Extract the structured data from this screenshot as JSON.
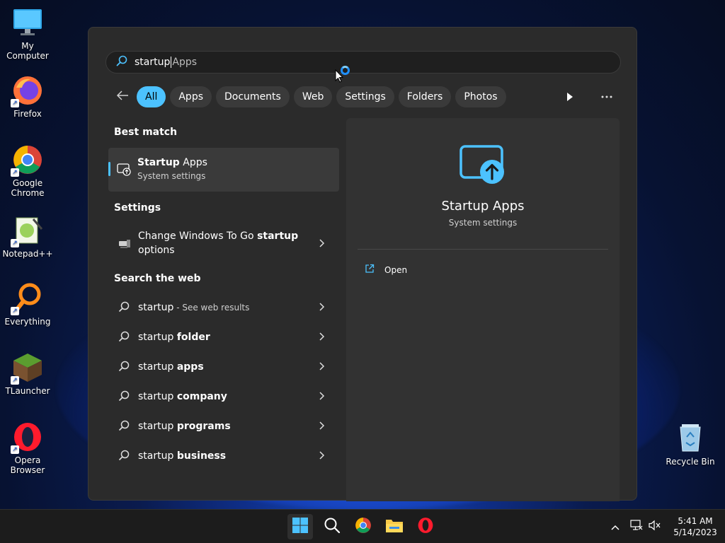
{
  "desktop": {
    "icons": [
      {
        "label": "My Computer",
        "icon": "computer-icon",
        "shortcut": false
      },
      {
        "label": "Firefox",
        "icon": "firefox-icon",
        "shortcut": true
      },
      {
        "label": "Google Chrome",
        "icon": "chrome-icon",
        "shortcut": true
      },
      {
        "label": "Notepad++",
        "icon": "notepadpp-icon",
        "shortcut": true
      },
      {
        "label": "Everything",
        "icon": "everything-icon",
        "shortcut": true
      },
      {
        "label": "TLauncher",
        "icon": "tlauncher-icon",
        "shortcut": true
      },
      {
        "label": "Opera Browser",
        "icon": "opera-icon",
        "shortcut": true
      }
    ],
    "recycle_bin": {
      "label": "Recycle Bin",
      "icon": "recycle-bin-icon"
    }
  },
  "search": {
    "typed": "startup",
    "suggestion": "Apps",
    "icon": "search-icon"
  },
  "filters": {
    "back_icon": "back-arrow-icon",
    "chips": [
      {
        "label": "All",
        "active": true
      },
      {
        "label": "Apps",
        "active": false
      },
      {
        "label": "Documents",
        "active": false
      },
      {
        "label": "Web",
        "active": false
      },
      {
        "label": "Settings",
        "active": false
      },
      {
        "label": "Folders",
        "active": false
      },
      {
        "label": "Photos",
        "active": false
      }
    ],
    "play_icon": "play-icon",
    "more_icon": "more-icon"
  },
  "best_match": {
    "section_title": "Best match",
    "title_bold": "Startup",
    "title_rest": " Apps",
    "subtitle": "System settings"
  },
  "settings": {
    "section_title": "Settings",
    "items": [
      {
        "pre": "Change Windows To Go ",
        "bold": "startup",
        "post": " options"
      }
    ]
  },
  "web": {
    "section_title": "Search the web",
    "items": [
      {
        "pre": "startup",
        "bold": "",
        "suffix": " - See web results"
      },
      {
        "pre": "startup ",
        "bold": "folder",
        "suffix": ""
      },
      {
        "pre": "startup ",
        "bold": "apps",
        "suffix": ""
      },
      {
        "pre": "startup ",
        "bold": "company",
        "suffix": ""
      },
      {
        "pre": "startup ",
        "bold": "programs",
        "suffix": ""
      },
      {
        "pre": "startup ",
        "bold": "business",
        "suffix": ""
      }
    ]
  },
  "preview": {
    "title": "Startup Apps",
    "subtitle": "System settings",
    "open_label": "Open"
  },
  "taskbar": {
    "apps": [
      "start-icon",
      "search-icon",
      "chrome-icon",
      "file-explorer-icon",
      "opera-icon"
    ],
    "clock_time": "5:41 AM",
    "clock_date": "5/14/2023"
  },
  "colors": {
    "accent": "#4cc2ff",
    "panel_bg": "#2b2b2b",
    "taskbar_bg": "#1c1c1c"
  }
}
